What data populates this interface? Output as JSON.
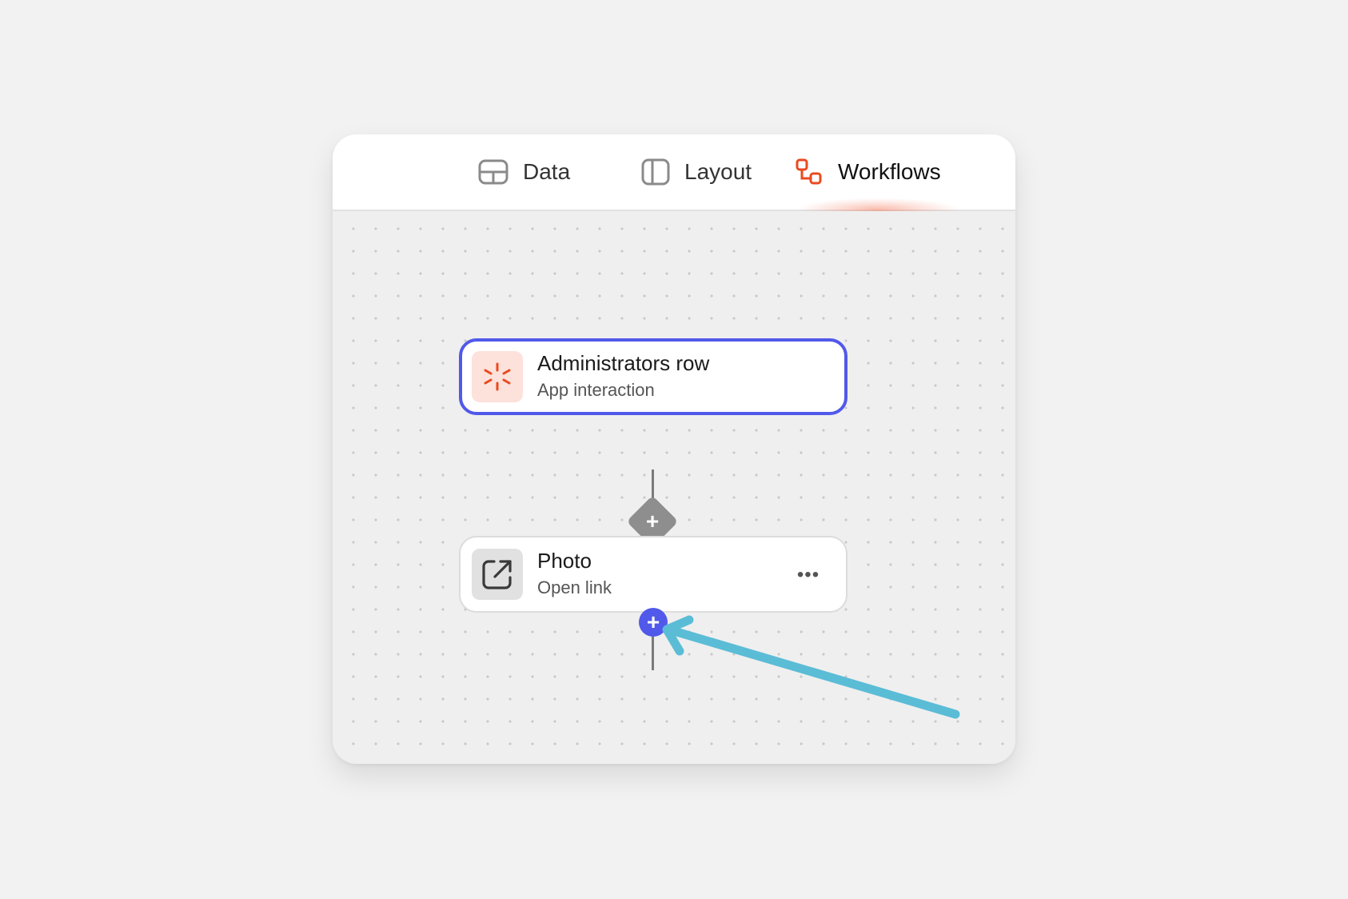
{
  "tabs": [
    {
      "label": "Data",
      "icon": "table-grid-icon",
      "active": false
    },
    {
      "label": "Layout",
      "icon": "layout-columns-icon",
      "active": false
    },
    {
      "label": "Workflows",
      "icon": "workflow-nodes-icon",
      "active": true
    }
  ],
  "workflow": {
    "trigger": {
      "title": "Administrators row",
      "subtitle": "App interaction",
      "icon": "sparkle-burst-icon",
      "selected": true
    },
    "insert_button": "+",
    "action": {
      "title": "Photo",
      "subtitle": "Open link",
      "icon": "external-link-icon",
      "more_label": "•••"
    },
    "add_step_button": "+"
  },
  "colors": {
    "accent": "#5159ea",
    "workflows_brand": "#ea4a1f",
    "trigger_icon_bg": "#fde1db",
    "annotation_arrow": "#5bbcd6"
  }
}
